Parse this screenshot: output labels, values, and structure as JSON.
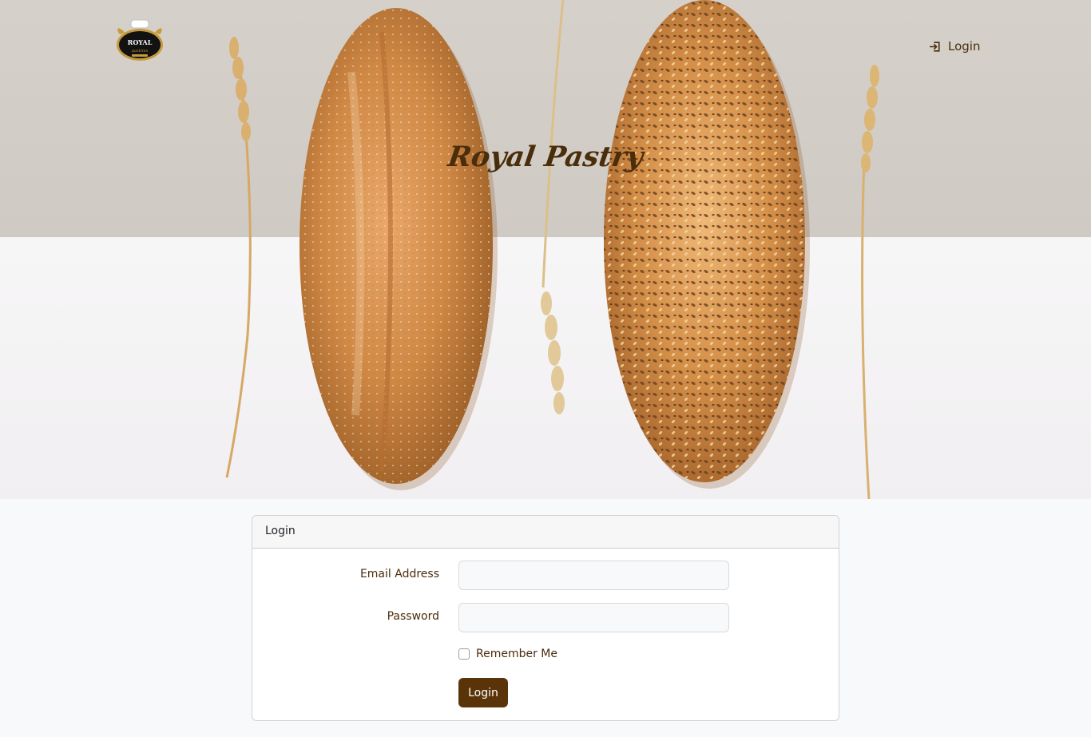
{
  "brand": {
    "logo_text": "ROYAL",
    "logo_subtext": "pastries",
    "title": "Royal Pastry"
  },
  "nav": {
    "login_label": "Login",
    "login_icon": "login-icon"
  },
  "login_card": {
    "header": "Login",
    "email_label": "Email Address",
    "email_value": "",
    "password_label": "Password",
    "password_value": "",
    "remember_label": "Remember Me",
    "remember_checked": false,
    "submit_label": "Login"
  },
  "colors": {
    "brand_brown": "#5a3408",
    "text_brown": "#4a2d0b",
    "page_bg": "#f8f9fa"
  }
}
